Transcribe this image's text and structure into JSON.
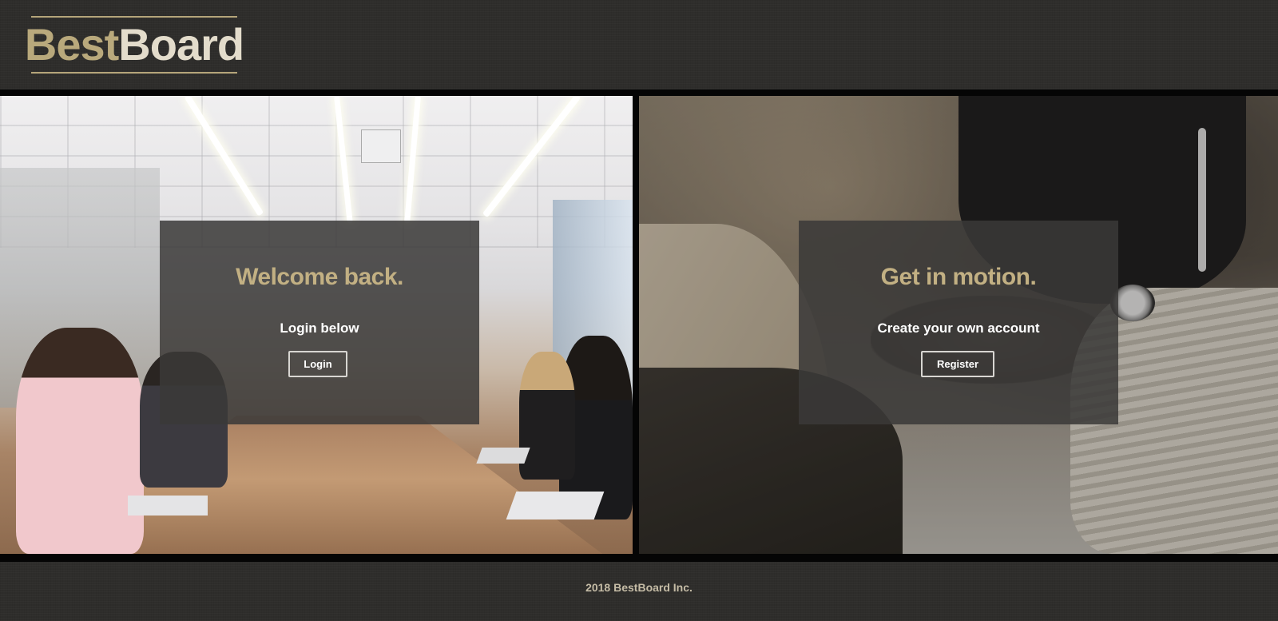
{
  "header": {
    "logo_part1": "Best",
    "logo_part2": "Board"
  },
  "login_panel": {
    "title": "Welcome back.",
    "subtitle": "Login below",
    "button_label": "Login"
  },
  "register_panel": {
    "title": "Get in motion.",
    "subtitle": "Create your own account",
    "button_label": "Register"
  },
  "footer": {
    "text": "2018 BestBoard Inc."
  },
  "colors": {
    "accent_gold": "#c2b083",
    "logo_light": "#e3dccb",
    "background": "#2e2d2b",
    "card_overlay": "#3a3938"
  }
}
